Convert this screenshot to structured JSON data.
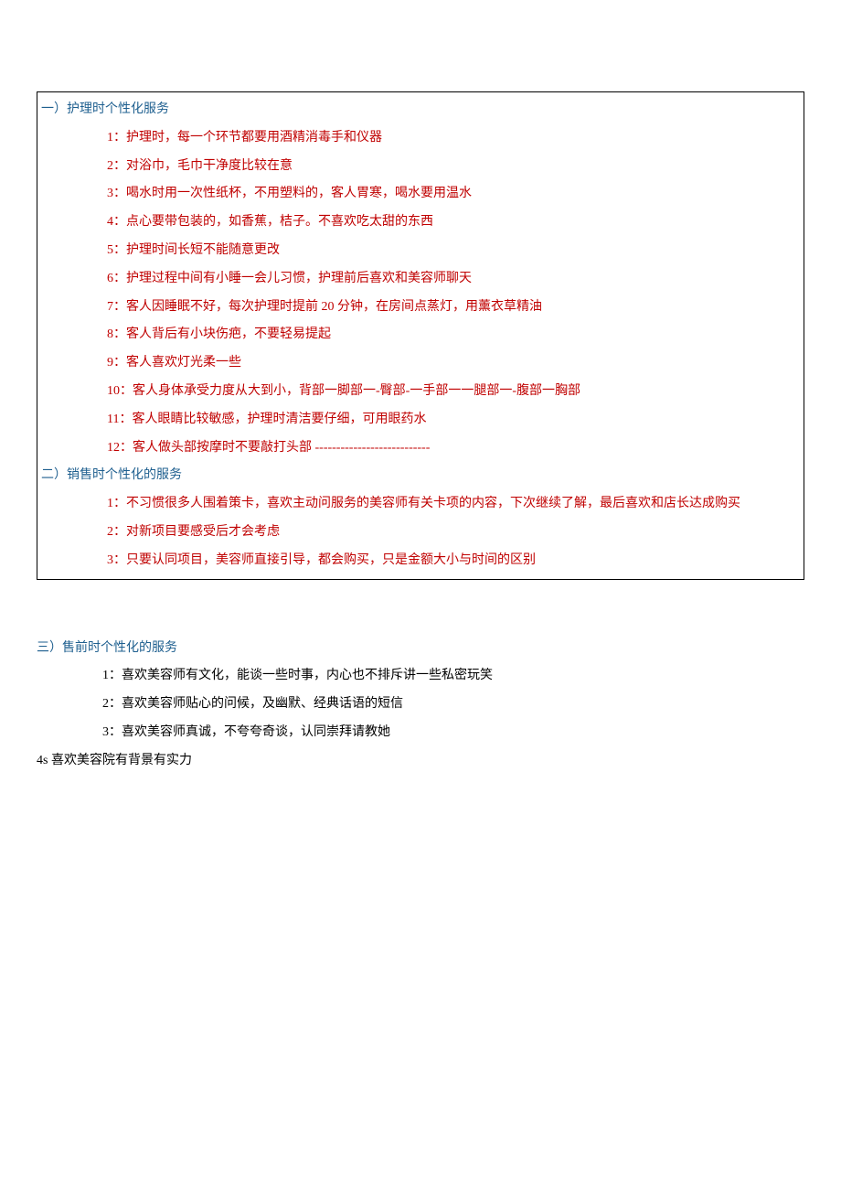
{
  "box": {
    "section1": {
      "heading": "一）护理时个性化服务",
      "items": [
        "1：护理时，每一个环节都要用酒精消毒手和仪器",
        "2：对浴巾，毛巾干净度比较在意",
        "3：喝水时用一次性纸杯，不用塑料的，客人胃寒，喝水要用温水",
        "4：点心要带包装的，如香蕉，桔子。不喜欢吃太甜的东西",
        "5：护理时间长短不能随意更改",
        "6：护理过程中间有小睡一会儿习惯，护理前后喜欢和美容师聊天",
        "7：客人因睡眠不好，每次护理时提前 20 分钟，在房间点蒸灯，用薰衣草精油",
        "8：客人背后有小块伤疤，不要轻易提起",
        "9：客人喜欢灯光柔一些",
        "10：客人身体承受力度从大到小，背部一脚部一-臀部-一手部一一腿部一-腹部一胸部",
        "11：客人眼睛比较敏感，护理时清洁要仔细，可用眼药水"
      ],
      "item12_prefix": "12：客人做头部按摩时不要敲打头部 ",
      "item12_dashes": "---------------------------"
    },
    "section2": {
      "heading": "二）销售时个性化的服务",
      "items": [
        "1：不习惯很多人围着策卡，喜欢主动问服务的美容师有关卡项的内容，下次继续了解，最后喜欢和店长达成购买",
        "2：对新项目要感受后才会考虑",
        "3：只要认同项目，美容师直接引导，都会购买，只是金额大小与时间的区别"
      ]
    }
  },
  "outside": {
    "section3": {
      "heading": "三）售前时个性化的服务",
      "items": [
        "1：喜欢美容师有文化，能谈一些时事，内心也不排斥讲一些私密玩笑",
        "2：喜欢美容师贴心的问候，及幽默、经典话语的短信",
        "3：喜欢美容师真诚，不夸夸奇谈，认同崇拜请教她"
      ],
      "lastLine": "4s 喜欢美容院有背景有实力"
    }
  }
}
